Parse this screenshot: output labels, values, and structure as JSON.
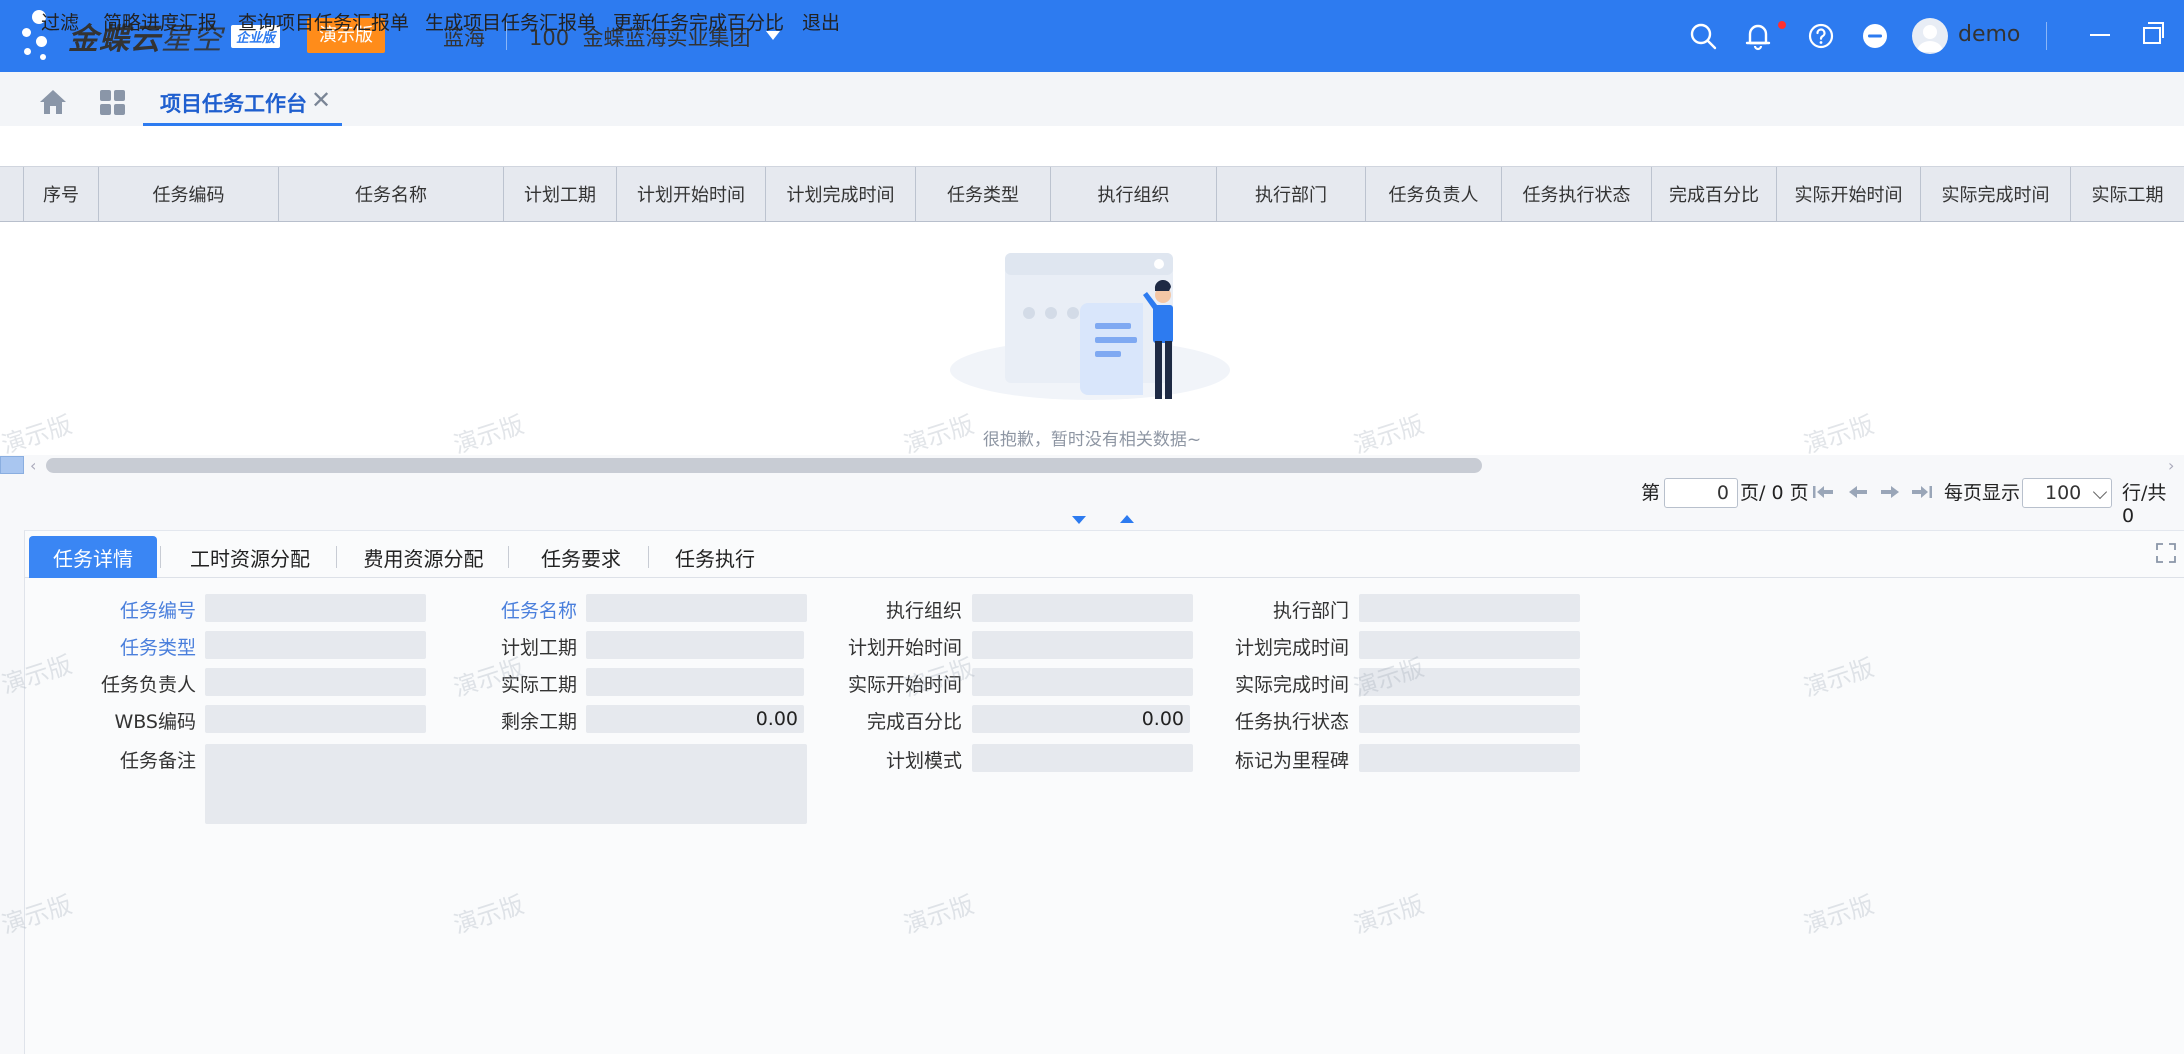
{
  "app": {
    "logo_main": "金蝶云",
    "logo_sub": "星空",
    "edition_badge": "企业版",
    "demo_badge": "演示版",
    "org_short": "蓝海",
    "org_code": "100",
    "org_name": "金蝶蓝海实业集团",
    "user_name": "demo",
    "accent": "#2d7bf0"
  },
  "tabs": {
    "active_tab": "项目任务工作台",
    "close_glyph": "✕"
  },
  "toolbar": {
    "items": [
      "过滤",
      "简略进度汇报",
      "查询项目任务汇报单",
      "生成项目任务汇报单",
      "更新任务完成百分比",
      "退出"
    ]
  },
  "grid": {
    "columns": [
      "序号",
      "任务编码",
      "任务名称",
      "计划工期",
      "计划开始时间",
      "计划完成时间",
      "任务类型",
      "执行组织",
      "执行部门",
      "任务负责人",
      "任务执行状态",
      "完成百分比",
      "实际开始时间",
      "实际完成时间",
      "实际工期"
    ],
    "empty_text": "很抱歉，暂时没有相关数据~"
  },
  "pager": {
    "label_page": "第",
    "current_page": "0",
    "label_of": "页/ 0 页",
    "label_per_page": "每页显示",
    "page_size": "100",
    "label_total": "行/共 0"
  },
  "detail": {
    "tabs": [
      "任务详情",
      "工时资源分配",
      "费用资源分配",
      "任务要求",
      "任务执行"
    ],
    "fields": {
      "task_code": {
        "label": "任务编号",
        "value": ""
      },
      "task_name": {
        "label": "任务名称",
        "value": ""
      },
      "exec_org": {
        "label": "执行组织",
        "value": ""
      },
      "exec_dept": {
        "label": "执行部门",
        "value": ""
      },
      "task_type": {
        "label": "任务类型",
        "value": ""
      },
      "plan_duration": {
        "label": "计划工期",
        "value": ""
      },
      "plan_start": {
        "label": "计划开始时间",
        "value": ""
      },
      "plan_finish": {
        "label": "计划完成时间",
        "value": ""
      },
      "owner": {
        "label": "任务负责人",
        "value": ""
      },
      "actual_duration": {
        "label": "实际工期",
        "value": ""
      },
      "actual_start": {
        "label": "实际开始时间",
        "value": ""
      },
      "actual_finish": {
        "label": "实际完成时间",
        "value": ""
      },
      "wbs_code": {
        "label": "WBS编码",
        "value": ""
      },
      "remaining_duration": {
        "label": "剩余工期",
        "value": "0.00"
      },
      "percent_complete": {
        "label": "完成百分比",
        "value": "0.00"
      },
      "exec_status": {
        "label": "任务执行状态",
        "value": ""
      },
      "remark": {
        "label": "任务备注",
        "value": ""
      },
      "plan_mode": {
        "label": "计划模式",
        "value": ""
      },
      "milestone": {
        "label": "标记为里程碑",
        "value": ""
      }
    }
  },
  "watermark": "演示版"
}
